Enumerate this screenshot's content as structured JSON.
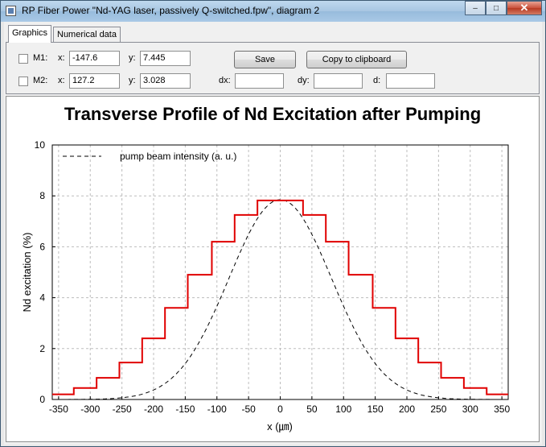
{
  "window": {
    "title": "RP Fiber Power \"Nd-YAG laser, passively Q-switched.fpw\", diagram 2",
    "min_glyph": "–",
    "max_glyph": "□",
    "close_glyph": "✕"
  },
  "tabs": [
    "Graphics",
    "Numerical data"
  ],
  "markers": {
    "m1": {
      "label": "M1:",
      "x_label": "x:",
      "x": "-147.6",
      "y_label": "y:",
      "y": "7.445"
    },
    "m2": {
      "label": "M2:",
      "x_label": "x:",
      "x": "127.2",
      "y_label": "y:",
      "y": "3.028"
    },
    "dx_label": "dx:",
    "dy_label": "dy:",
    "d_label": "d:",
    "dx": "",
    "dy": "",
    "d": ""
  },
  "buttons": {
    "save": "Save",
    "copy": "Copy to clipboard"
  },
  "chart_data": {
    "type": "line",
    "title": "Transverse Profile of Nd Excitation after Pumping",
    "xlabel": "x (㎛)",
    "ylabel": "Nd excitation (%)",
    "xlim": [
      -360,
      360
    ],
    "ylim": [
      0,
      10
    ],
    "xticks": [
      -350,
      -300,
      -250,
      -200,
      -150,
      -100,
      -50,
      0,
      50,
      100,
      150,
      200,
      250,
      300,
      350
    ],
    "yticks": [
      0,
      2,
      4,
      6,
      8,
      10
    ],
    "grid": true,
    "legend": {
      "position": "top-left",
      "entries": [
        "pump beam intensity (a. u.)"
      ]
    },
    "series": [
      {
        "name": "pump beam intensity (a. u.)",
        "style": "dashed",
        "color": "#000000",
        "gaussian": {
          "amplitude": 7.85,
          "width": 162
        }
      },
      {
        "style": "step",
        "color": "#e00000",
        "edges": [
          -360,
          -326,
          -290,
          -254,
          -218,
          -182,
          -146,
          -108,
          -72,
          -36,
          36,
          72,
          108,
          146,
          182,
          218,
          254,
          290,
          326,
          360
        ],
        "values": [
          0.2,
          0.45,
          0.85,
          1.45,
          2.4,
          3.6,
          4.9,
          6.2,
          7.25,
          7.82,
          7.25,
          6.2,
          4.9,
          3.6,
          2.4,
          1.45,
          0.85,
          0.45,
          0.2
        ]
      }
    ]
  }
}
